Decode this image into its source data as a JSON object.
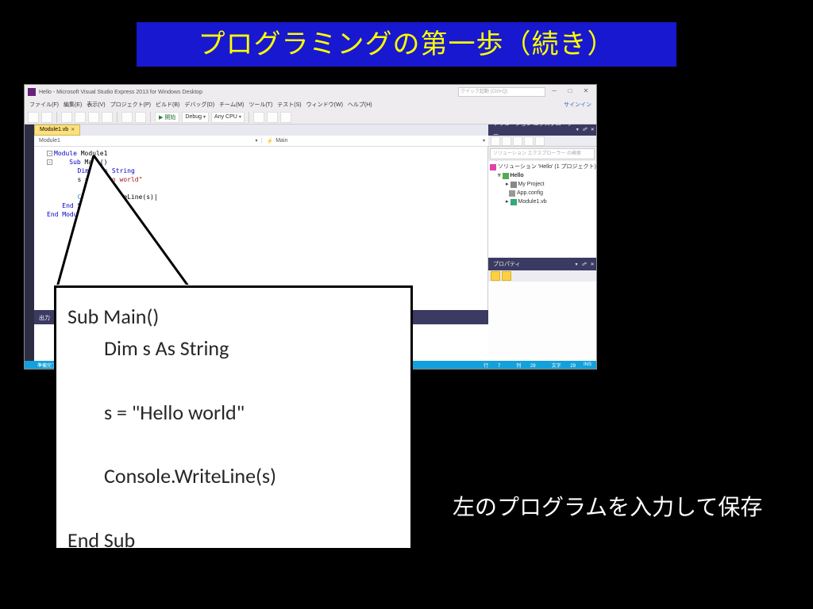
{
  "slide": {
    "title": "プログラミングの第一歩（続き）",
    "instruction": "左のプログラムを入力して保存"
  },
  "vs": {
    "title": "Hello - Microsoft Visual Studio Express 2013 for Windows Desktop",
    "quick_launch_placeholder": "クイック起動 (Ctrl+Q)",
    "signin": "サインイン",
    "menu": [
      "ファイル(F)",
      "編集(E)",
      "表示(V)",
      "プロジェクト(P)",
      "ビルド(B)",
      "デバッグ(D)",
      "チーム(M)",
      "ツール(T)",
      "テスト(S)",
      "ウィンドウ(W)",
      "ヘルプ(H)"
    ],
    "toolbar": {
      "start": "開始",
      "config": "Debug",
      "platform": "Any CPU"
    },
    "tab": "Module1.vb",
    "docnav_left": "Module1",
    "docnav_right": "Main",
    "code": {
      "l1a": "Module",
      "l1b": " Module1",
      "l2a": "Sub",
      "l2b": " Main()",
      "l3a": "Dim",
      "l3b": " s ",
      "l3c": "As String",
      "l4a": "s = ",
      "l4b": "\"Hello world\"",
      "l5a": "Console",
      "l5b": ".WriteLine(s)",
      "l6": "End Sub",
      "l7": "End Module"
    },
    "bottom_panel": "出力",
    "solution": {
      "title": "ソリューション エクスプローラー",
      "search_placeholder": "ソリューション エクスプローラー の検索 (Ctrl+;)",
      "root": "ソリューション 'Hello' (1 プロジェクト)",
      "project": "Hello",
      "myproject": "My Project",
      "appconfig": "App.config",
      "module": "Module1.vb"
    },
    "properties": {
      "title": "プロパティ"
    },
    "status": {
      "left": "準備完了",
      "line_lbl": "行",
      "line_val": "7",
      "col_lbl": "列",
      "col_val": "29",
      "ch_lbl": "文字",
      "ch_val": "29",
      "ins": "INS"
    }
  },
  "callout": {
    "l1": "Sub Main()",
    "l2": "Dim s As String",
    "l3": "s = \"Hello world\"",
    "l4": "Console.WriteLine(s)",
    "l5": "End Sub"
  }
}
